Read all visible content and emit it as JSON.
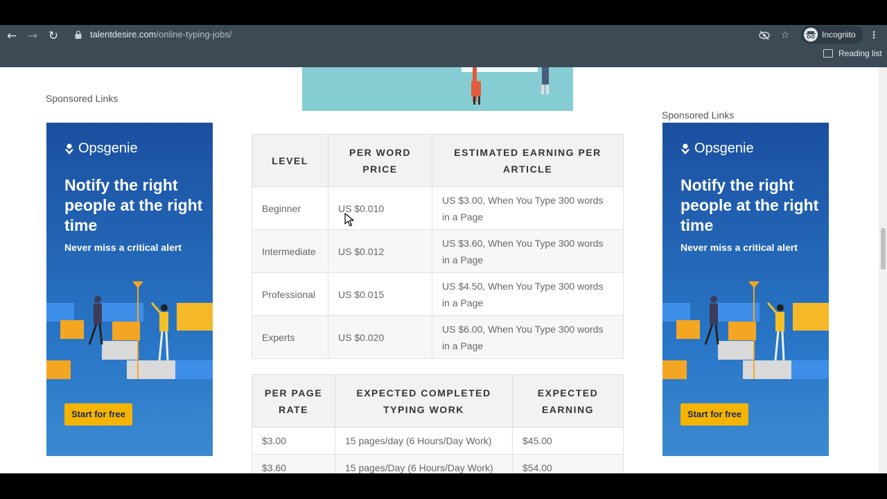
{
  "browser": {
    "url_domain": "talentdesire.com",
    "url_path": "/online-typing-jobs/",
    "incognito_label": "Incognito",
    "reading_list_label": "Reading list"
  },
  "sponsored": {
    "left_label": "Sponsored Links",
    "right_label": "Sponsored Links"
  },
  "ad": {
    "brand": "Opsgenie",
    "headline": "Notify the right people at the right time",
    "sub": "Never miss a critical alert",
    "cta": "Start for free"
  },
  "table1": {
    "headers": [
      "LEVEL",
      "PER WORD PRICE",
      "ESTIMATED EARNING PER ARTICLE"
    ],
    "rows": [
      [
        "Beginner",
        "US $0.010",
        "US $3.00, When You Type 300 words in a Page"
      ],
      [
        "Intermediate",
        "US $0.012",
        "US $3.60, When You Type 300 words in a Page"
      ],
      [
        "Professional",
        "US $0.015",
        "US $4.50, When You Type 300 words in a Page"
      ],
      [
        "Experts",
        "US $0.020",
        "US $6.00, When You Type 300 words in a Page"
      ]
    ]
  },
  "table2": {
    "headers": [
      "PER PAGE RATE",
      "EXPECTED COMPLETED TYPING WORK",
      "EXPECTED EARNING"
    ],
    "rows": [
      [
        "$3.00",
        "15 pages/day (6 Hours/Day Work)",
        "$45.00"
      ],
      [
        "$3.60",
        "15 pages/Day (6 Hours/Day Work)",
        "$54.00"
      ]
    ]
  }
}
